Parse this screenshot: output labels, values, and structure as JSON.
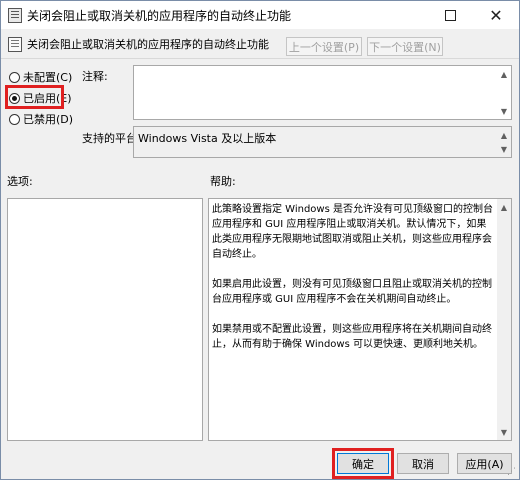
{
  "window": {
    "title": "关闭会阻止或取消关机的应用程序的自动终止功能",
    "maximize_icon": "maximize-icon",
    "close_glyph": "✕"
  },
  "header": {
    "policy_name": "关闭会阻止或取消关机的应用程序的自动终止功能",
    "prev_label": "上一个设置(P)",
    "next_label": "下一个设置(N)"
  },
  "state": {
    "options": [
      {
        "label": "未配置(C)",
        "checked": false
      },
      {
        "label": "已启用(E)",
        "checked": true
      },
      {
        "label": "已禁用(D)",
        "checked": false
      }
    ]
  },
  "comment": {
    "label": "注释:",
    "value": ""
  },
  "platform": {
    "label": "支持的平台:",
    "value": "Windows Vista 及以上版本"
  },
  "options_panel": {
    "label": "选项:"
  },
  "help_panel": {
    "label": "帮助:",
    "paragraphs": [
      "此策略设置指定 Windows 是否允许没有可见顶级窗口的控制台应用程序和 GUI 应用程序阻止或取消关机。默认情况下，如果此类应用程序无限期地试图取消或阻止关机，则这些应用程序会自动终止。",
      "如果启用此设置，则没有可见顶级窗口且阻止或取消关机的控制台应用程序或 GUI 应用程序不会在关机期间自动终止。",
      "如果禁用或不配置此设置，则这些应用程序将在关机期间自动终止，从而有助于确保 Windows 可以更快速、更顺利地关机。"
    ]
  },
  "buttons": {
    "ok": "确定",
    "cancel": "取消",
    "apply": "应用(A)"
  },
  "colors": {
    "highlight": "#e02020",
    "focus": "#0078d7"
  }
}
